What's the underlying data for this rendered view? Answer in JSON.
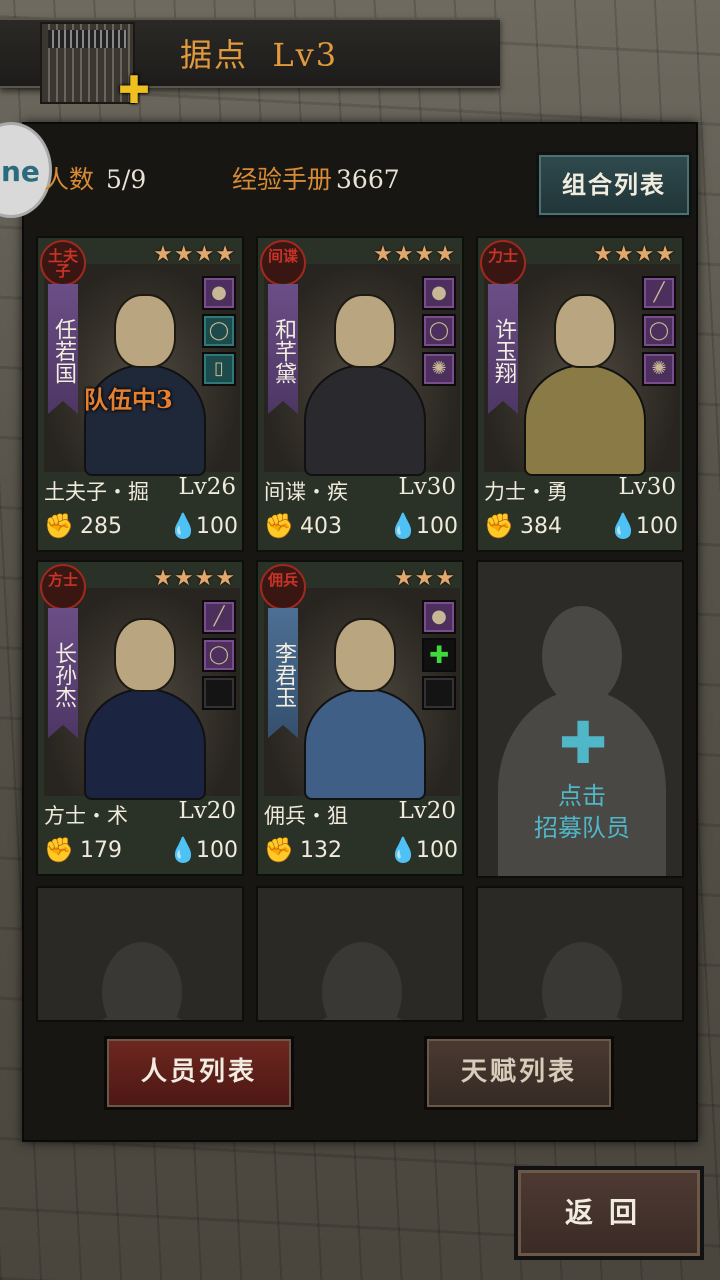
{
  "header": {
    "title": "据点",
    "level": "Lv3"
  },
  "side_bubble": {
    "text": "ne"
  },
  "stats": {
    "headcount_label": "人数",
    "headcount_value": "5/9",
    "exp_label": "经验手册",
    "exp_value": "3667"
  },
  "combo_button_label": "组合列表",
  "members": [
    {
      "badge": "土夫子",
      "name": "任若国",
      "stars": "★★★★",
      "team": "队伍中3",
      "class_line": "土夫子・掘",
      "level": "Lv26",
      "power": "285",
      "morale": "100",
      "equip_icons": [
        "grenade-icon",
        "ring-icon",
        "phone-icon"
      ],
      "ribbon": "purple"
    },
    {
      "badge": "间谍",
      "name": "和芊黛",
      "stars": "★★★★",
      "class_line": "间谍・疾",
      "level": "Lv30",
      "power": "403",
      "morale": "100",
      "equip_icons": [
        "grenade-icon",
        "ring-icon",
        "amulet-icon"
      ],
      "ribbon": "purple"
    },
    {
      "badge": "力士",
      "name": "许玉翔",
      "stars": "★★★★",
      "class_line": "力士・勇",
      "level": "Lv30",
      "power": "384",
      "morale": "100",
      "equip_icons": [
        "knife-icon",
        "ring-icon",
        "amulet-icon"
      ],
      "ribbon": "purple"
    },
    {
      "badge": "方士",
      "name": "长孙杰",
      "stars": "★★★★",
      "class_line": "方士・术",
      "level": "Lv20",
      "power": "179",
      "morale": "100",
      "equip_icons": [
        "knife-icon",
        "ring-icon",
        "empty-slot-icon"
      ],
      "ribbon": "purple"
    },
    {
      "badge": "佣兵",
      "name": "李君玉",
      "stars": "★★★",
      "class_line": "佣兵・狙",
      "level": "Lv20",
      "power": "132",
      "morale": "100",
      "equip_icons": [
        "grenade-icon",
        "add-equip-icon",
        "empty-slot-icon"
      ],
      "ribbon": "blue"
    }
  ],
  "recruit": {
    "line1": "点击",
    "line2": "招募队员"
  },
  "tabs": {
    "members_label": "人员列表",
    "talents_label": "天赋列表"
  },
  "back_label": "返回",
  "colors": {
    "accent_orange": "#e09a3c",
    "recruit_cyan": "#4fb7c8",
    "badge_red": "#c93328"
  }
}
